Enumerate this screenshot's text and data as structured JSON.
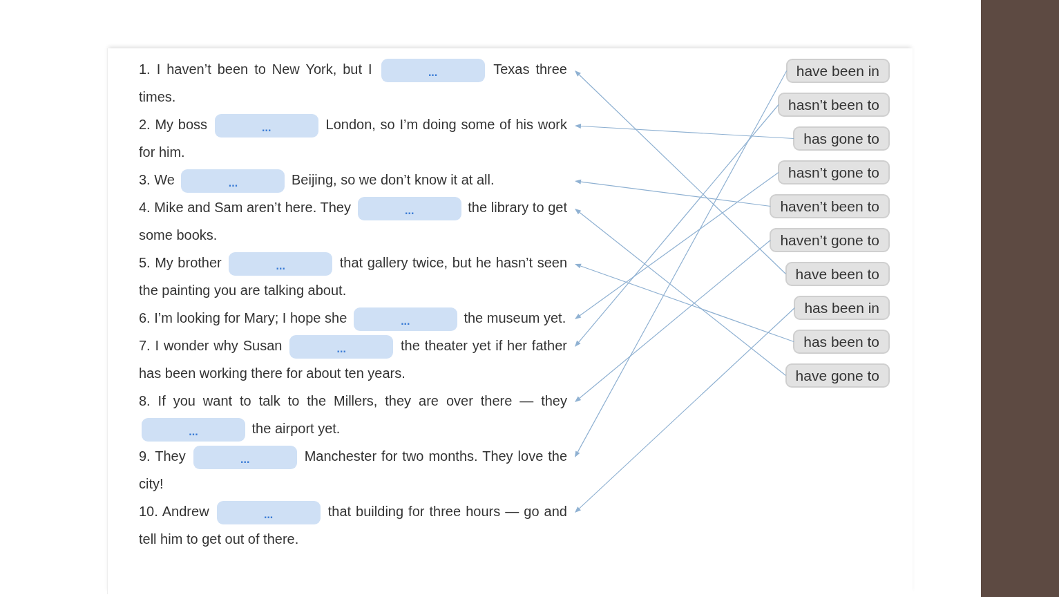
{
  "sentences": [
    {
      "before": "1. I haven’t been to New York, but I",
      "blank": "...",
      "after": "Texas three times."
    },
    {
      "before": "2. My boss",
      "blank": "...",
      "after": "London, so I’m doing some of his work for him."
    },
    {
      "before": "3. We",
      "blank": "...",
      "after": "Beijing, so we don’t know it at all."
    },
    {
      "before": "4. Mike and Sam aren’t here. They",
      "blank": "...",
      "after": "the library to get some books."
    },
    {
      "before": "5. My brother",
      "blank": "...",
      "after": "that gallery twice, but he hasn’t seen the painting you are talking about."
    },
    {
      "before": "6. I’m looking for Mary; I hope she",
      "blank": "...",
      "after": "the museum yet."
    },
    {
      "before": "7. I wonder why Susan",
      "blank": "...",
      "after": "the theater yet if her father has been working there for about ten years."
    },
    {
      "before": "8. If you want to talk to the Millers, they are over there — they",
      "blank": "...",
      "after": "the airport yet."
    },
    {
      "before": "9. They",
      "blank": "...",
      "after": "Manchester for two months. They love the city!"
    },
    {
      "before": "10. Andrew",
      "blank": "...",
      "after": "that building for three hours — go and tell him to get out of there."
    }
  ],
  "options": [
    "have been in",
    "hasn’t been to",
    "has gone to",
    "hasn’t gone to",
    "haven’t been to",
    "haven’t gone to",
    "have been to",
    "has been in",
    "has been to",
    "have gone to"
  ]
}
